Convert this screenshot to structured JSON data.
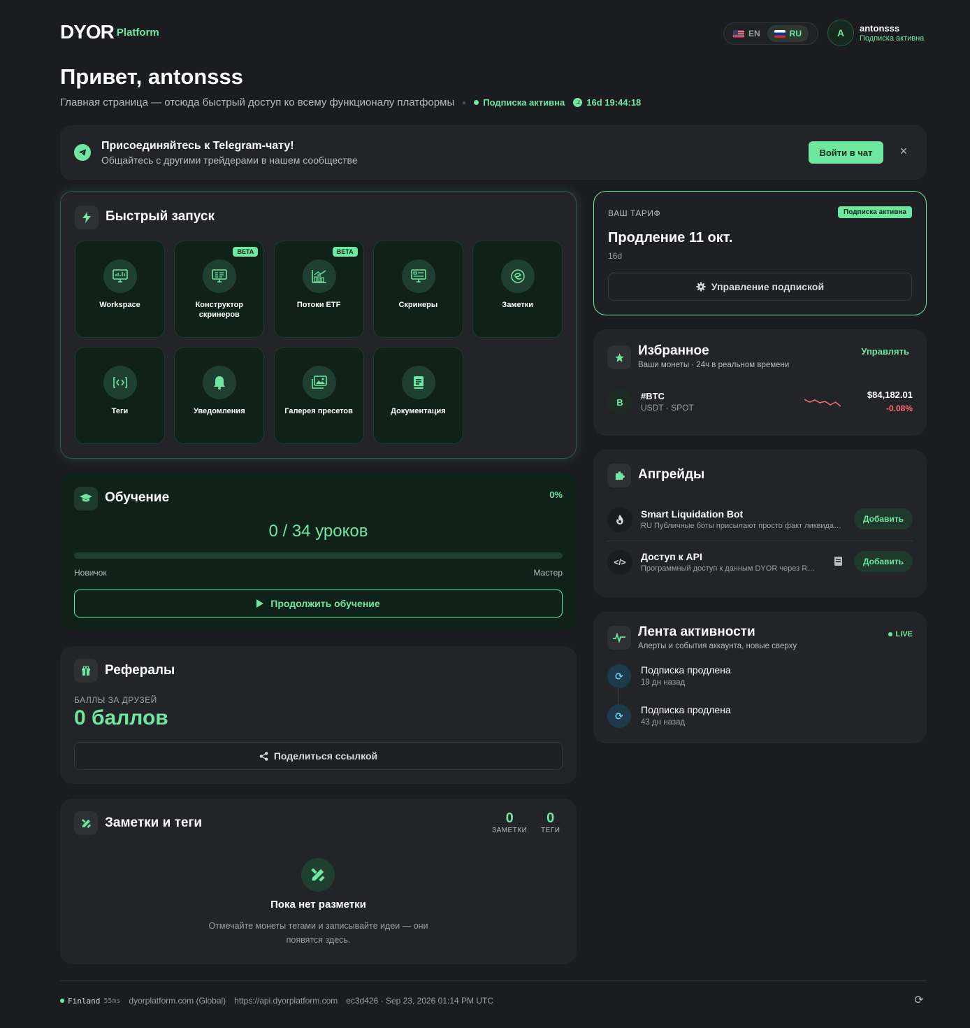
{
  "header": {
    "logo_mark": "DYOR",
    "logo_text": "Platform",
    "lang_en": "EN",
    "lang_ru": "RU",
    "active_lang": "RU",
    "avatar_letter": "A",
    "user_name": "antonsss",
    "user_status": "Подписка активна"
  },
  "hero": {
    "greeting": "Привет, antonsss",
    "subtitle": "Главная страница — отсюда быстрый доступ ко всему функционалу платформы",
    "sub_status": "Подписка активна",
    "timer": "16d 19:44:18"
  },
  "telegram": {
    "title": "Присоединяйтесь к Telegram-чату!",
    "subtitle": "Общайтесь с другими трейдерами в нашем сообществе",
    "button": "Войти в чат",
    "close": "×"
  },
  "quick_launch": {
    "title": "Быстрый запуск",
    "tiles": [
      {
        "label": "Workspace",
        "icon": "monitor-chart-icon",
        "badge": ""
      },
      {
        "label": "Конструктор скринеров",
        "icon": "screener-builder-icon",
        "badge": "BETA"
      },
      {
        "label": "Потоки ETF",
        "icon": "bar-chart-icon",
        "badge": "BETA"
      },
      {
        "label": "Скринеры",
        "icon": "screener-icon",
        "badge": ""
      },
      {
        "label": "Заметки",
        "icon": "notes-icon",
        "badge": ""
      },
      {
        "label": "Теги",
        "icon": "tag-code-icon",
        "badge": ""
      },
      {
        "label": "Уведомления",
        "icon": "bell-icon",
        "badge": ""
      },
      {
        "label": "Галерея пресетов",
        "icon": "gallery-icon",
        "badge": ""
      },
      {
        "label": "Документация",
        "icon": "document-icon",
        "badge": ""
      }
    ]
  },
  "learning": {
    "title": "Обучение",
    "percent": "0%",
    "progress_fraction": 0,
    "lessons": "0 / 34 уроков",
    "level_start": "Новичок",
    "level_end": "Мастер",
    "button": "Продолжить обучение"
  },
  "referrals": {
    "title": "Рефералы",
    "label": "БАЛЛЫ ЗА ДРУЗЕЙ",
    "value": "0 баллов",
    "button": "Поделиться ссылкой"
  },
  "notes_tags": {
    "title": "Заметки и теги",
    "notes_count": "0",
    "notes_label": "ЗАМЕТКИ",
    "tags_count": "0",
    "tags_label": "ТЕГИ",
    "empty_title": "Пока нет разметки",
    "empty_sub": "Отмечайте монеты тегами и записывайте идеи — они появятся здесь."
  },
  "plan": {
    "label": "ВАШ ТАРИФ",
    "badge": "Подписка активна",
    "title": "Продление 11 окт.",
    "sub": "16d",
    "button": "Управление подпиской"
  },
  "favorites": {
    "title": "Избранное",
    "subtitle": "Ваши монеты · 24ч в реальном времени",
    "manage": "Управлять",
    "coin": {
      "avatar": "B",
      "name": "#BTC",
      "sub": "USDT · SPOT",
      "price": "$84,182.01",
      "change": "-0.08%",
      "sparkline": [
        0.35,
        0.55,
        0.4,
        0.6,
        0.5,
        0.75,
        0.55,
        0.85
      ]
    }
  },
  "upgrades": {
    "title": "Апгрейды",
    "items": [
      {
        "icon": "flame-icon",
        "name": "Smart Liquidation Bot",
        "desc": "RU Публичные боты присылают просто факт ликвидации",
        "button": "Добавить"
      },
      {
        "icon": "code-icon",
        "name": "Доступ к API",
        "desc": "Программный доступ к данным DYOR через REST API",
        "button": "Добавить"
      }
    ]
  },
  "activity": {
    "title": "Лента активности",
    "subtitle": "Алерты и события аккаунта, новые сверху",
    "live": "LIVE",
    "items": [
      {
        "title": "Подписка продлена",
        "time": "19 дн назад"
      },
      {
        "title": "Подписка продлена",
        "time": "43 дн назад"
      }
    ]
  },
  "footer": {
    "region": "Finland",
    "latency": "55ms",
    "domain": "dyorplatform.com (Global)",
    "api": "https://api.dyorplatform.com",
    "build": "ec3d426 · Sep 23, 2026 01:14 PM UTC"
  },
  "colors": {
    "accent": "#6ee7a0",
    "background": "#1b1c1f",
    "card": "#232428",
    "negative": "#f87171"
  }
}
